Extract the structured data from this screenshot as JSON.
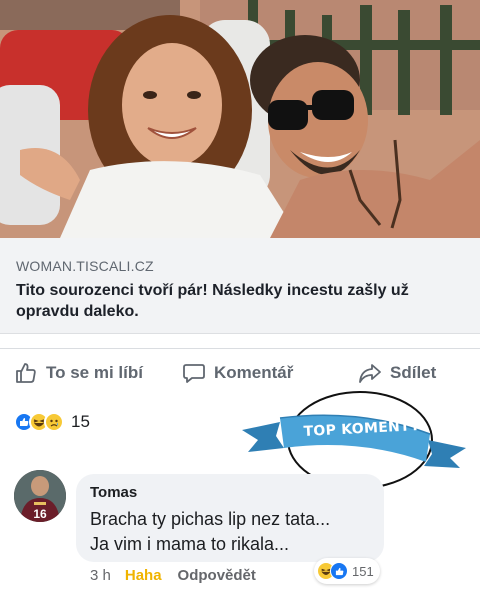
{
  "link": {
    "domain": "WOMAN.TISCALI.CZ",
    "title": "Tito sourozenci tvoří pár! Následky incestu zašly už opravdu daleko."
  },
  "actions": {
    "like_label": "To se mi líbí",
    "comment_label": "Komentář",
    "share_label": "Sdílet"
  },
  "reactions": {
    "icons": [
      "like-icon",
      "haha-icon",
      "sad-icon"
    ],
    "count": "15"
  },
  "banner": {
    "text": "TOP KOMENTY",
    "color": "#4aa3d8"
  },
  "comment": {
    "author": "Tomas",
    "text_line1": "Bracha ty pichas lip nez tata...",
    "text_line2": "Ja vim i mama to rikala...",
    "time": "3 h",
    "reaction_label": "Haha",
    "reply_label": "Odpovědět",
    "reaction_icons": [
      "haha-icon",
      "like-icon"
    ],
    "reaction_count": "151",
    "avatar_jersey_number": "16"
  },
  "colors": {
    "link_bg": "#f2f3f5",
    "action_text": "#606770",
    "like_blue": "#1877f2",
    "haha_yellow": "#f7c936"
  }
}
